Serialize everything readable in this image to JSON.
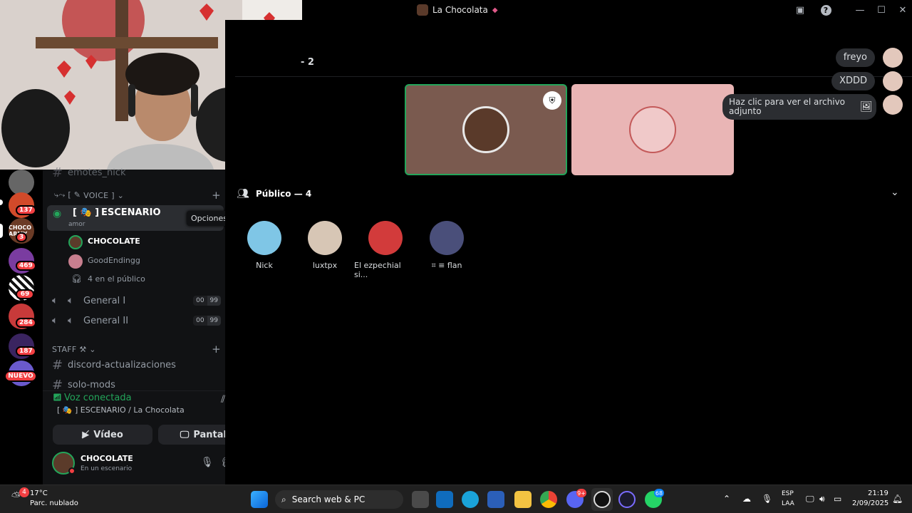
{
  "window": {
    "title": "La Chocolata"
  },
  "stage": {
    "speakers_count": "2"
  },
  "chat_messages": [
    {
      "text": "freyo"
    },
    {
      "text": "XDDD"
    },
    {
      "text": "Haz clic para ver el archivo adjunto"
    }
  ],
  "guilds": [
    {
      "badge": "137"
    },
    {
      "badge": "3",
      "label": "CHOCO ARMY"
    },
    {
      "badge": "469"
    },
    {
      "badge": "69"
    },
    {
      "badge": "284"
    },
    {
      "badge": "187"
    },
    {
      "badge": "NUEVO"
    }
  ],
  "sidebar": {
    "top_channel": "emotes_nick",
    "voice_category": "VOICE",
    "stage_channel": "ESCENARIO",
    "stage_channel_prefix": "[ 🎭 ]",
    "stage_topic": "amor",
    "tooltip": "Opciones",
    "stage_users": [
      {
        "name": "CHOCOLATE"
      },
      {
        "name": "GoodEndingg"
      }
    ],
    "audience_line": "4 en el público",
    "voice_channels": [
      {
        "name": "General I",
        "count_a": "00",
        "count_b": "99"
      },
      {
        "name": "General II",
        "count_a": "00",
        "count_b": "99"
      }
    ],
    "staff_category": "STAFF ⚒",
    "text_channels": [
      "discord-actualizaciones",
      "solo-mods"
    ]
  },
  "voice_status": {
    "label": "Voz conectada",
    "location": "[ 🎭 ] ESCENARIO / La Chocolata",
    "video_label": "Vídeo",
    "screen_label": "Pantalla"
  },
  "user_panel": {
    "name": "CHOCOLATE",
    "status": "En un escenario"
  },
  "audience": {
    "header": "Público — 4",
    "members": [
      {
        "name": "Nick"
      },
      {
        "name": "luxtpx"
      },
      {
        "name": "El ezpechial si..."
      },
      {
        "name": "⌗ ≡ flan"
      }
    ]
  },
  "taskbar": {
    "weather_temp": "17°C",
    "weather_desc": "Parc. nublado",
    "weather_badge": "4",
    "search_placeholder": "Search web & PC",
    "discord_badge": "9+",
    "whatsapp_badge": "68",
    "lang": "ESP",
    "lang_sub": "LAA",
    "time": "21:19",
    "date": "2/09/2025"
  },
  "colors": {
    "accent_green": "#23a55a",
    "danger": "#f23f42",
    "tile_brown": "#7a5a4f",
    "tile_pink": "#e9b5b5"
  }
}
